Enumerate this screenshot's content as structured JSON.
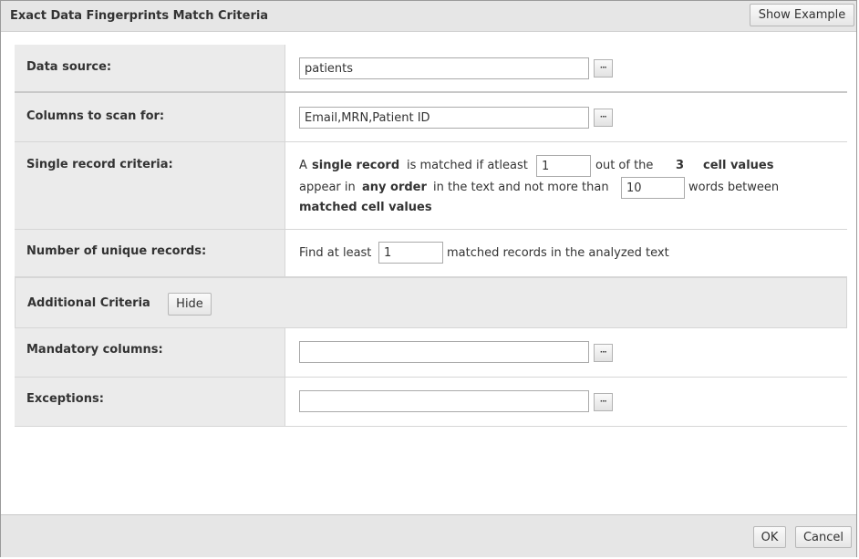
{
  "dialog": {
    "title": "Exact Data Fingerprints Match Criteria",
    "show_example_label": "Show Example"
  },
  "data_source": {
    "label": "Data source:",
    "value": "patients",
    "browse_label": "···"
  },
  "columns_to_scan": {
    "label": "Columns to scan for:",
    "value": "Email,MRN,Patient ID",
    "browse_label": "···"
  },
  "single_record": {
    "label": "Single record criteria:",
    "text_a": "A",
    "text_single_record": "single record",
    "text_is_matched": "is matched if atleast",
    "atleast_value": "1",
    "text_out_of_the": "out of the",
    "cell_count": "3",
    "text_cell_values": "cell values",
    "text_appear_in": "appear in",
    "text_any_order": "any order",
    "text_in_the_text": "in the text and not more than",
    "words_between_value": "10",
    "text_words_between": "words between",
    "text_matched_cell_values": "matched cell values"
  },
  "unique_records": {
    "label": "Number of unique records:",
    "text_find_at_least": "Find at least",
    "value": "1",
    "text_matched_records": "matched records in the analyzed text"
  },
  "additional_criteria": {
    "label": "Additional Criteria",
    "hide_label": "Hide"
  },
  "mandatory_columns": {
    "label": "Mandatory columns:",
    "value": "",
    "browse_label": "···"
  },
  "exceptions": {
    "label": "Exceptions:",
    "value": "",
    "browse_label": "···"
  },
  "footer": {
    "ok_label": "OK",
    "cancel_label": "Cancel"
  }
}
